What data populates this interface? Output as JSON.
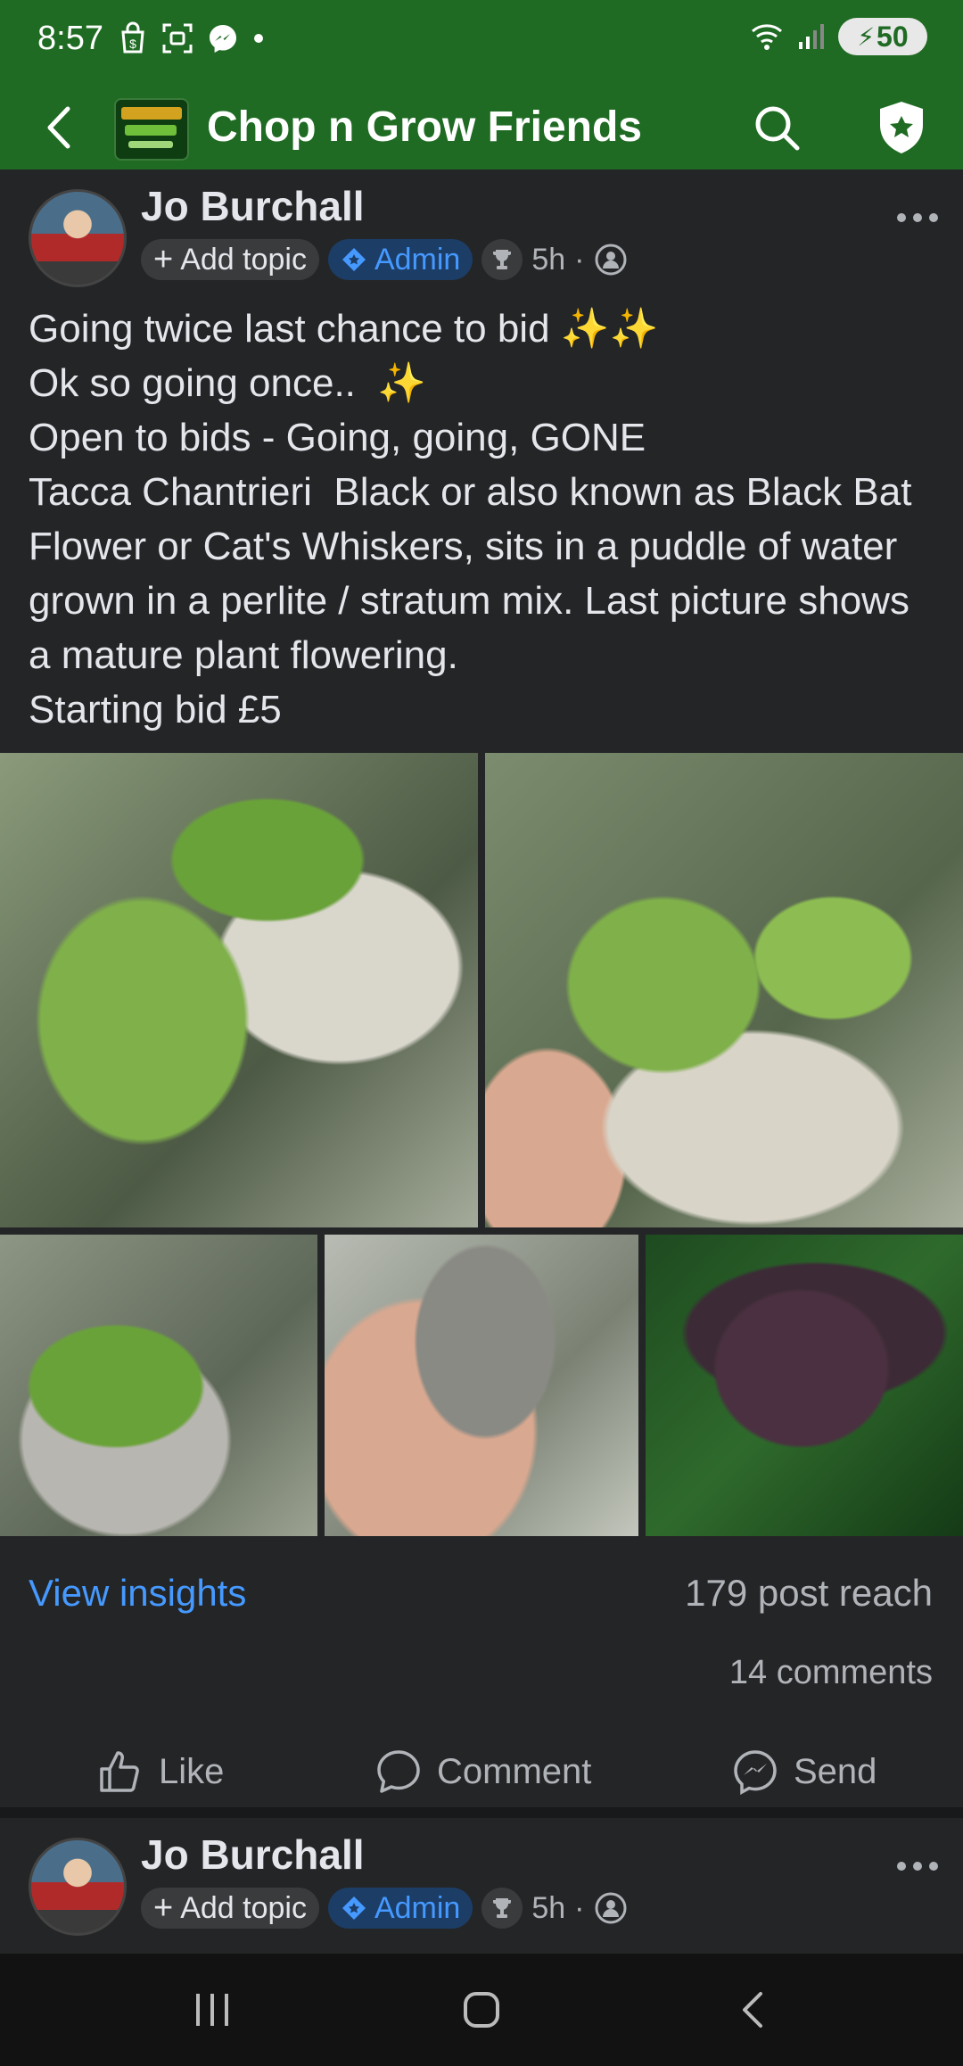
{
  "status_bar": {
    "time": "8:57",
    "battery": "50",
    "left_icons": [
      "shopping-bag-icon",
      "screenshot-icon",
      "messenger-icon",
      "dot-icon"
    ],
    "right_icons": [
      "wifi-icon",
      "signal-icon",
      "battery-icon"
    ]
  },
  "app_bar": {
    "title": "Chop n Grow Friends",
    "accent_color": "#1f6b23"
  },
  "post": {
    "author": "Jo Burchall",
    "add_topic": "Add topic",
    "admin_badge": "Admin",
    "time": "5h",
    "text_lines": [
      "Going twice last chance to bid",
      "Ok so going once..",
      "Open to bids - Going, going, GONE",
      "Tacca Chantrieri  Black or also known as Black Bat Flower or Cat's Whiskers, sits in a puddle of water grown in a perlite / stratum mix. Last picture shows a mature plant flowering.",
      "Starting bid £5"
    ],
    "sparkles_line1": "✨✨",
    "sparkles_line2": "✨",
    "photo_count": 5,
    "view_insights": "View insights",
    "reach": "179 post reach",
    "comments": "14 comments",
    "actions": {
      "like": "Like",
      "comment": "Comment",
      "send": "Send"
    }
  },
  "next_post": {
    "author": "Jo Burchall",
    "add_topic": "Add topic",
    "admin_badge": "Admin",
    "time": "5h"
  },
  "colors": {
    "background": "#242526",
    "link": "#4599ff",
    "admin_chip_bg": "#1c3d66"
  }
}
